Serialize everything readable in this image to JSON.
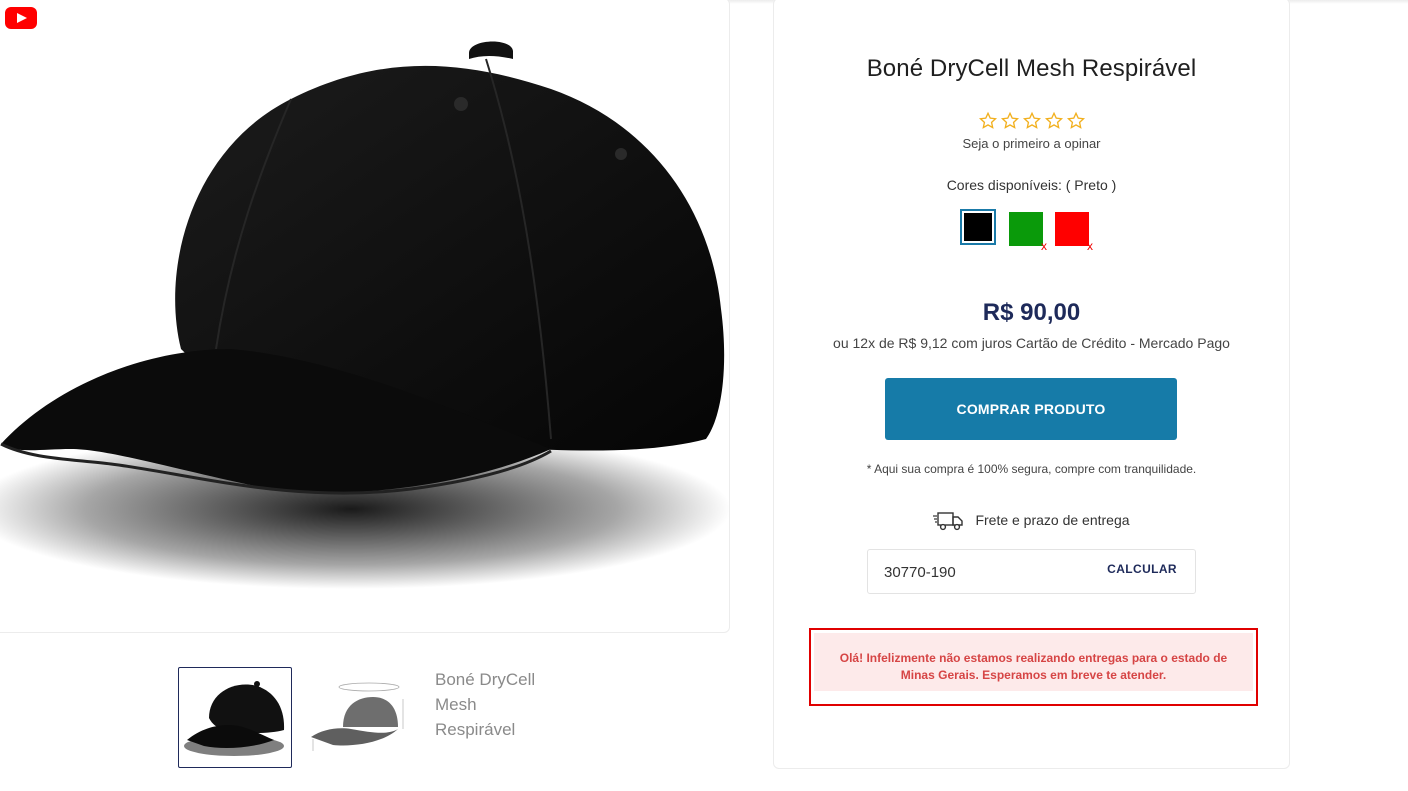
{
  "product": {
    "title": "Boné DryCell Mesh Respirável",
    "rating_stars": 5,
    "review_prompt": "Seja o primeiro a opinar",
    "colors_label": "Cores disponíveis: ( Preto )",
    "colors": [
      {
        "name": "Preto",
        "hex": "#000000",
        "selected": true,
        "available": true
      },
      {
        "name": "Verde",
        "hex": "#0a9a0a",
        "selected": false,
        "available": false
      },
      {
        "name": "Vermelho",
        "hex": "#ff0000",
        "selected": false,
        "available": false
      }
    ],
    "unavailable_mark": "x",
    "price": "R$ 90,00",
    "installments": "ou 12x de R$ 9,12 com juros Cartão de Crédito - Mercado Pago",
    "buy_button": "COMPRAR PRODUTO",
    "secure_note": "* Aqui sua compra é 100% segura, compre com tranquilidade."
  },
  "shipping": {
    "label": "Frete e prazo de entrega",
    "cep_value": "30770-190",
    "calc_button": "CALCULAR",
    "alert_message": "Olá! Infelizmente não estamos realizando entregas para o estado de Minas Gerais. Esperamos em breve te atender."
  },
  "gallery": {
    "broken_thumb_alt": "Boné DryCell Mesh Respirável",
    "icons": [
      "youtube-icon",
      "truck-icon",
      "star-icon"
    ]
  },
  "colors_theme": {
    "accent": "#167ba8",
    "price": "#1e2a5a",
    "alert_border": "#e00000",
    "alert_bg": "#fdeaea",
    "star": "#f2b01e"
  }
}
